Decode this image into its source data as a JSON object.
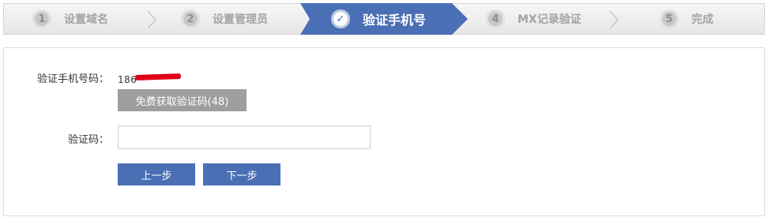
{
  "steps": [
    {
      "number": "1",
      "label": "设置域名"
    },
    {
      "number": "2",
      "label": "设置管理员"
    },
    {
      "number": "✓",
      "label": "验证手机号"
    },
    {
      "number": "4",
      "label": "MX记录验证"
    },
    {
      "number": "5",
      "label": "完成"
    }
  ],
  "form": {
    "phone_label": "验证手机号码：",
    "phone_value": "186               ",
    "get_code_button": "免费获取验证码(48)",
    "code_label": "验证码：",
    "code_value": "",
    "prev_button": "上一步",
    "next_button": "下一步"
  },
  "colors": {
    "accent": "#4a6fb5",
    "step_bar_bg": "#ececec",
    "disabled_button": "#9e9e9e",
    "redaction": "#e0001a"
  }
}
